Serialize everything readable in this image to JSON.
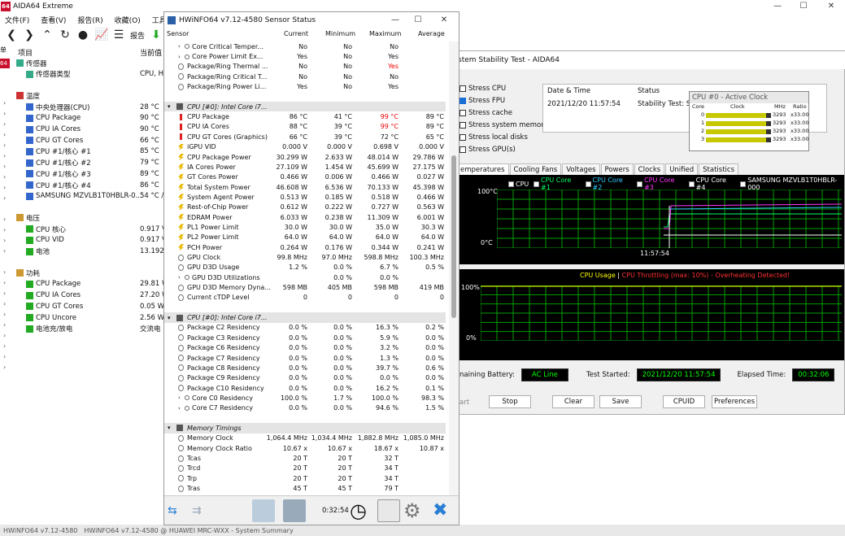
{
  "aida": {
    "logo": "64",
    "title": "AIDA64 Extreme",
    "menu": [
      "文件(F)",
      "查看(V)",
      "报告(R)",
      "收藏(O)",
      "工具(T)"
    ],
    "report_label": "报告",
    "col_item": "项目",
    "col_value": "当前值",
    "left_strip": [
      "单",
      "64"
    ],
    "sensor_header": "传感器",
    "sensor_type_label": "传感器类型",
    "sensor_type_value": "CPU, HI",
    "temp_header": "温度",
    "temps": [
      {
        "label": "中央处理器(CPU)",
        "value": "28 °C"
      },
      {
        "label": "CPU Package",
        "value": "90 °C"
      },
      {
        "label": "CPU IA Cores",
        "value": "90 °C"
      },
      {
        "label": "CPU GT Cores",
        "value": "66 °C"
      },
      {
        "label": "CPU #1/核心 #1",
        "value": "85 °C"
      },
      {
        "label": "CPU #1/核心 #2",
        "value": "79 °C"
      },
      {
        "label": "CPU #1/核心 #3",
        "value": "89 °C"
      },
      {
        "label": "CPU #1/核心 #4",
        "value": "86 °C"
      },
      {
        "label": "SAMSUNG MZVLB1T0HBLR-0...",
        "value": "54 °C /"
      }
    ],
    "volt_header": "电压",
    "volts": [
      {
        "label": "CPU 核心",
        "value": "0.917 V"
      },
      {
        "label": "CPU VID",
        "value": "0.917 V"
      },
      {
        "label": "电池",
        "value": "13.192"
      }
    ],
    "power_header": "功耗",
    "powers": [
      {
        "label": "CPU Package",
        "value": "29.81 W"
      },
      {
        "label": "CPU IA Cores",
        "value": "27.20 W"
      },
      {
        "label": "CPU GT Cores",
        "value": "0.05 W"
      },
      {
        "label": "CPU Uncore",
        "value": "2.56 W"
      },
      {
        "label": "电池充/放电",
        "value": "交流电"
      }
    ],
    "taskbar": [
      "HWiNFO64 v7.12-4580",
      "HWiNFO64 v7.12-4580 @ HUAWEI MRC-WXX - System Summary"
    ]
  },
  "stability": {
    "title": "stem Stability Test - AIDA64",
    "stress": [
      {
        "label": "Stress CPU",
        "checked": false
      },
      {
        "label": "Stress FPU",
        "checked": true
      },
      {
        "label": "Stress cache",
        "checked": false
      },
      {
        "label": "Stress system memory",
        "checked": false
      },
      {
        "label": "Stress local disks",
        "checked": false
      },
      {
        "label": "Stress GPU(s)",
        "checked": false
      }
    ],
    "col_date": "Date & Time",
    "col_status": "Status",
    "date_value": "2021/12/20 11:57:54",
    "status_value": "Stability Test: Sta",
    "clock_title": "CPU #0 - Active Clock",
    "clock_cols": [
      "Core",
      "Clock",
      "MHz",
      "Ratio"
    ],
    "clock_rows": [
      {
        "core": "0",
        "mhz": "3293",
        "ratio": "x33.00",
        "fill": 0.92
      },
      {
        "core": "1",
        "mhz": "3293",
        "ratio": "x33.00",
        "fill": 0.92
      },
      {
        "core": "2",
        "mhz": "3293",
        "ratio": "x33.00",
        "fill": 0.92
      },
      {
        "core": "3",
        "mhz": "3293",
        "ratio": "x33.00",
        "fill": 0.92
      }
    ],
    "tabs": [
      "emperatures",
      "Cooling Fans",
      "Voltages",
      "Powers",
      "Clocks",
      "Unified",
      "Statistics"
    ],
    "legend": [
      {
        "label": "CPU",
        "color": "#ffffff"
      },
      {
        "label": "CPU Core #1",
        "color": "#00ff66"
      },
      {
        "label": "CPU Core #2",
        "color": "#33ccff"
      },
      {
        "label": "CPU Core #3",
        "color": "#ff33ff"
      },
      {
        "label": "CPU Core #4",
        "color": "#ffffff"
      },
      {
        "label": "SAMSUNG MZVLB1T0HBLR-000",
        "color": "#ffffff"
      }
    ],
    "temp_top": "100°C",
    "temp_bottom": "0°C",
    "time_label": "11:57:54",
    "usage_title": "CPU Usage",
    "throttle_title": "CPU Throttling (max: 10%) - Overheating Detected!",
    "usage_top": "100%",
    "usage_bottom": "0%",
    "battery_label": "naining Battery:",
    "battery_value": "AC Line",
    "started_label": "Test Started:",
    "started_value": "2021/12/20 11:57:54",
    "elapsed_label": "Elapsed Time:",
    "elapsed_value": "00:32:06",
    "buttons": [
      "art",
      "Stop",
      "Clear",
      "Save",
      "CPUID",
      "Preferences"
    ],
    "colors": {
      "graph_green": "#00a000",
      "text_green": "#00ff00",
      "alert_red": "#ff3030",
      "usage_yellow": "#ffff00"
    }
  },
  "hwinfo": {
    "title": "HWiNFO64 v7.12-4580 Sensor Status",
    "cols": [
      "Sensor",
      "Current",
      "Minimum",
      "Maximum",
      "Average"
    ],
    "rows": [
      {
        "type": "exp",
        "name": "Core Critical Temper...",
        "c": "No",
        "mi": "No",
        "ma": "No",
        "av": ""
      },
      {
        "type": "exp",
        "name": "Core Power Limit Ex...",
        "c": "Yes",
        "mi": "No",
        "ma": "Yes",
        "av": ""
      },
      {
        "type": "item",
        "name": "Package/Ring Thermal ...",
        "c": "No",
        "mi": "No",
        "ma": "Yes",
        "av": "",
        "red": true
      },
      {
        "type": "item",
        "name": "Package/Ring Critical T...",
        "c": "No",
        "mi": "No",
        "ma": "No",
        "av": ""
      },
      {
        "type": "item",
        "name": "Package/Ring Power Li...",
        "c": "Yes",
        "mi": "No",
        "ma": "Yes",
        "av": ""
      },
      {
        "type": "blank"
      },
      {
        "type": "sec",
        "name": "CPU [#0]: Intel Core i7..."
      },
      {
        "type": "t",
        "name": "CPU Package",
        "c": "86 °C",
        "mi": "41 °C",
        "ma": "99 °C",
        "av": "89 °C",
        "red": true
      },
      {
        "type": "t",
        "name": "CPU IA Cores",
        "c": "88 °C",
        "mi": "39 °C",
        "ma": "99 °C",
        "av": "89 °C",
        "red": true
      },
      {
        "type": "t",
        "name": "CPU GT Cores (Graphics)",
        "c": "66 °C",
        "mi": "39 °C",
        "ma": "72 °C",
        "av": "65 °C"
      },
      {
        "type": "v",
        "name": "iGPU VID",
        "c": "0.000 V",
        "mi": "0.000 V",
        "ma": "0.698 V",
        "av": "0.000 V"
      },
      {
        "type": "p",
        "name": "CPU Package Power",
        "c": "30.299 W",
        "mi": "2.633 W",
        "ma": "48.014 W",
        "av": "29.786 W"
      },
      {
        "type": "p",
        "name": "IA Cores Power",
        "c": "27.109 W",
        "mi": "1.454 W",
        "ma": "45.699 W",
        "av": "27.175 W"
      },
      {
        "type": "p",
        "name": "GT Cores Power",
        "c": "0.466 W",
        "mi": "0.006 W",
        "ma": "0.466 W",
        "av": "0.027 W"
      },
      {
        "type": "p",
        "name": "Total System Power",
        "c": "46.608 W",
        "mi": "6.536 W",
        "ma": "70.133 W",
        "av": "45.398 W"
      },
      {
        "type": "p",
        "name": "System Agent Power",
        "c": "0.513 W",
        "mi": "0.185 W",
        "ma": "0.518 W",
        "av": "0.466 W"
      },
      {
        "type": "p",
        "name": "Rest-of-Chip Power",
        "c": "0.612 W",
        "mi": "0.222 W",
        "ma": "0.727 W",
        "av": "0.563 W"
      },
      {
        "type": "p",
        "name": "EDRAM Power",
        "c": "6.033 W",
        "mi": "0.238 W",
        "ma": "11.309 W",
        "av": "6.001 W"
      },
      {
        "type": "p",
        "name": "PL1 Power Limit",
        "c": "30.0 W",
        "mi": "30.0 W",
        "ma": "35.0 W",
        "av": "30.3 W"
      },
      {
        "type": "p",
        "name": "PL2 Power Limit",
        "c": "64.0 W",
        "mi": "64.0 W",
        "ma": "64.0 W",
        "av": "64.0 W"
      },
      {
        "type": "p",
        "name": "PCH Power",
        "c": "0.264 W",
        "mi": "0.176 W",
        "ma": "0.344 W",
        "av": "0.241 W"
      },
      {
        "type": "k",
        "name": "GPU Clock",
        "c": "99.8 MHz",
        "mi": "97.0 MHz",
        "ma": "598.8 MHz",
        "av": "100.3 MHz"
      },
      {
        "type": "k",
        "name": "GPU D3D Usage",
        "c": "1.2 %",
        "mi": "0.0 %",
        "ma": "6.7 %",
        "av": "0.5 %"
      },
      {
        "type": "exp",
        "name": "GPU D3D Utilizations",
        "c": "",
        "mi": "0.0 %",
        "ma": "0.0 %",
        "av": ""
      },
      {
        "type": "k",
        "name": "GPU D3D Memory Dyna...",
        "c": "598 MB",
        "mi": "405 MB",
        "ma": "598 MB",
        "av": "419 MB"
      },
      {
        "type": "k",
        "name": "Current cTDP Level",
        "c": "0",
        "mi": "0",
        "ma": "0",
        "av": "0"
      },
      {
        "type": "blank"
      },
      {
        "type": "sec",
        "name": "CPU [#0]: Intel Core i7..."
      },
      {
        "type": "k",
        "name": "Package C2 Residency",
        "c": "0.0 %",
        "mi": "0.0 %",
        "ma": "16.3 %",
        "av": "0.2 %"
      },
      {
        "type": "k",
        "name": "Package C3 Residency",
        "c": "0.0 %",
        "mi": "0.0 %",
        "ma": "5.9 %",
        "av": "0.0 %"
      },
      {
        "type": "k",
        "name": "Package C6 Residency",
        "c": "0.0 %",
        "mi": "0.0 %",
        "ma": "3.2 %",
        "av": "0.0 %"
      },
      {
        "type": "k",
        "name": "Package C7 Residency",
        "c": "0.0 %",
        "mi": "0.0 %",
        "ma": "1.3 %",
        "av": "0.0 %"
      },
      {
        "type": "k",
        "name": "Package C8 Residency",
        "c": "0.0 %",
        "mi": "0.0 %",
        "ma": "39.7 %",
        "av": "0.6 %"
      },
      {
        "type": "k",
        "name": "Package C9 Residency",
        "c": "0.0 %",
        "mi": "0.0 %",
        "ma": "0.0 %",
        "av": "0.0 %"
      },
      {
        "type": "k",
        "name": "Package C10 Residency",
        "c": "0.0 %",
        "mi": "0.0 %",
        "ma": "16.2 %",
        "av": "0.1 %"
      },
      {
        "type": "exp",
        "name": "Core C0 Residency",
        "c": "100.0 %",
        "mi": "1.7 %",
        "ma": "100.0 %",
        "av": "98.3 %"
      },
      {
        "type": "exp",
        "name": "Core C7 Residency",
        "c": "0.0 %",
        "mi": "0.0 %",
        "ma": "94.6 %",
        "av": "1.5 %"
      },
      {
        "type": "blank"
      },
      {
        "type": "sec",
        "name": "Memory Timings"
      },
      {
        "type": "k",
        "name": "Memory Clock",
        "c": "1,064.4 MHz",
        "mi": "1,034.4 MHz",
        "ma": "1,882.8 MHz",
        "av": "1,085.0 MHz"
      },
      {
        "type": "k",
        "name": "Memory Clock Ratio",
        "c": "10.67 x",
        "mi": "10.67 x",
        "ma": "18.67 x",
        "av": "10.87 x"
      },
      {
        "type": "k",
        "name": "Tcas",
        "c": "20 T",
        "mi": "20 T",
        "ma": "32 T",
        "av": ""
      },
      {
        "type": "k",
        "name": "Trcd",
        "c": "20 T",
        "mi": "20 T",
        "ma": "34 T",
        "av": ""
      },
      {
        "type": "k",
        "name": "Trp",
        "c": "20 T",
        "mi": "20 T",
        "ma": "34 T",
        "av": ""
      },
      {
        "type": "k",
        "name": "Tras",
        "c": "45 T",
        "mi": "45 T",
        "ma": "79 T",
        "av": ""
      }
    ],
    "timer": "0:32:54"
  }
}
